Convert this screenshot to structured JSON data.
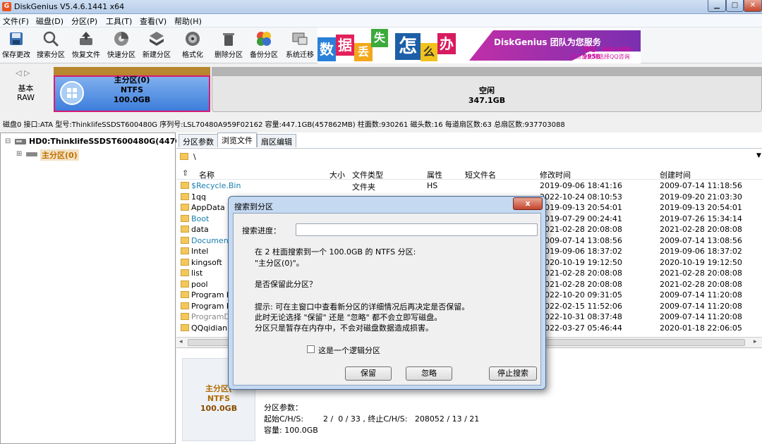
{
  "window": {
    "title": "DiskGenius V5.4.6.1441 x64",
    "icon_letter": "G",
    "min_glyph": "▁",
    "max_glyph": "□",
    "close_glyph": "✕"
  },
  "menu": [
    "文件(F)",
    "磁盘(D)",
    "分区(P)",
    "工具(T)",
    "查看(V)",
    "帮助(H)"
  ],
  "toolbar": [
    {
      "label": "保存更改",
      "icon": "save-icon"
    },
    {
      "label": "搜索分区",
      "icon": "search-icon"
    },
    {
      "label": "恢复文件",
      "icon": "recover-icon"
    },
    {
      "label": "快速分区",
      "icon": "quick-partition-icon"
    },
    {
      "label": "新建分区",
      "icon": "new-partition-icon"
    },
    {
      "label": "格式化",
      "icon": "format-icon"
    },
    {
      "label": "删除分区",
      "icon": "delete-icon"
    },
    {
      "label": "备份分区",
      "icon": "backup-icon"
    },
    {
      "label": "系统迁移",
      "icon": "migrate-icon"
    }
  ],
  "banner": {
    "tiles": [
      "数",
      "据",
      "丢",
      "失",
      "怎",
      "么",
      "办"
    ],
    "slogan": "DiskGenius 团队为您服务",
    "phone": "致电：400-008-9958",
    "qq": "或点击此处选择QQ咨询"
  },
  "diskmap": {
    "nav": "◁ ▷",
    "type_line1": "基本",
    "type_line2": "RAW",
    "main_name": "主分区(0)",
    "main_fs": "NTFS",
    "main_size": "100.0GB",
    "free_name": "空闲",
    "free_size": "347.1GB"
  },
  "disk_info": "磁盘0 接口:ATA 型号:ThinklifeSSDST600480G 序列号:LSL70480A959F02162 容量:447.1GB(457862MB) 柱面数:930261 磁头数:16 每道扇区数:63 总扇区数:937703088",
  "tree": {
    "expand1": "⊟",
    "disk": "HD0:ThinklifeSSDST600480G(447GB)",
    "expand2": "⊞",
    "partition": "主分区(0)"
  },
  "tabs": [
    "分区参数",
    "浏览文件",
    "扇区编辑"
  ],
  "path": "\\",
  "columns": [
    "名称",
    "大小",
    "文件类型",
    "属性",
    "短文件名",
    "修改时间",
    "创建时间"
  ],
  "files": [
    {
      "name": "$Recycle.Bin",
      "type": "文件夹",
      "attr": "HS",
      "mtime": "2019-09-06 18:41:16",
      "ctime": "2009-07-14 11:18:56"
    },
    {
      "name": "1qq",
      "type": "",
      "attr": "",
      "mtime": "2022-10-24 08:10:53",
      "ctime": "2019-09-20 21:03:30"
    },
    {
      "name": "AppData",
      "type": "",
      "attr": "",
      "mtime": "2019-09-13 20:54:01",
      "ctime": "2019-09-13 20:54:01"
    },
    {
      "name": "Boot",
      "type": "",
      "attr": "",
      "mtime": "2019-07-29 00:24:41",
      "ctime": "2019-07-26 15:34:14"
    },
    {
      "name": "data",
      "type": "",
      "attr": "",
      "mtime": "2021-02-28 20:08:08",
      "ctime": "2021-02-28 20:08:08"
    },
    {
      "name": "Document",
      "type": "",
      "attr": "",
      "mtime": "2009-07-14 13:08:56",
      "ctime": "2009-07-14 13:08:56"
    },
    {
      "name": "Intel",
      "type": "",
      "attr": "",
      "mtime": "2019-09-06 18:37:02",
      "ctime": "2019-09-06 18:37:02"
    },
    {
      "name": "kingsoft",
      "type": "",
      "attr": "",
      "mtime": "2020-10-19 19:12:50",
      "ctime": "2020-10-19 19:12:50"
    },
    {
      "name": "list",
      "type": "",
      "attr": "",
      "mtime": "2021-02-28 20:08:08",
      "ctime": "2021-02-28 20:08:08"
    },
    {
      "name": "pool",
      "type": "",
      "attr": "",
      "mtime": "2021-02-28 20:08:08",
      "ctime": "2021-02-28 20:08:08"
    },
    {
      "name": "Program F",
      "type": "",
      "attr": "",
      "mtime": "2022-10-20 09:31:05",
      "ctime": "2009-07-14 11:20:08"
    },
    {
      "name": "Program F",
      "type": "",
      "attr": "",
      "mtime": "2022-02-15 11:52:06",
      "ctime": "2009-07-14 11:20:08"
    },
    {
      "name": "ProgramD",
      "type": "",
      "attr": "",
      "mtime": "2022-10-31 08:37:48",
      "ctime": "2009-07-14 11:20:08"
    },
    {
      "name": "QQqidian",
      "type": "",
      "attr": "",
      "mtime": "2022-03-27 05:46:44",
      "ctime": "2020-01-18 22:06:05"
    }
  ],
  "detail": {
    "part_name": "主分区(",
    "part_fs": "NTFS",
    "part_size": "100.0GB",
    "params_title": "分区参数：",
    "start_label": "起始C/H/S:",
    "start_value": "2 /  0 / 33 , 终止C/H/S:   208052 / 13 / 21",
    "capacity": "容量: 100.0GB"
  },
  "dialog": {
    "title": "搜索到分区",
    "close": "x",
    "progress_label": "搜索进度：",
    "msg1": "在 2 柱面搜索到一个 100.0GB 的 NTFS 分区:",
    "msg2": "\"主分区(0)\"。",
    "question": "是否保留此分区？",
    "hint1": "提示: 可在主窗口中查看新分区的详细情况后再决定是否保留。",
    "hint2": "此时无论选择 \"保留\" 还是 \"忽略\" 都不会立即写磁盘。",
    "hint3": "分区只是暂存在内存中，不会对磁盘数据造成损害。",
    "checkbox": "这是一个逻辑分区",
    "btn_keep": "保留",
    "btn_ignore": "忽略",
    "btn_stop": "停止搜索"
  }
}
